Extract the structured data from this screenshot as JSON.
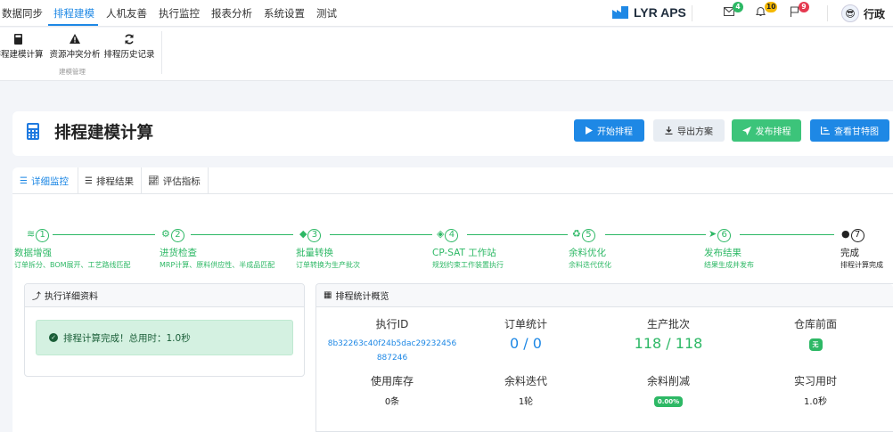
{
  "nav": {
    "items": [
      "数据同步",
      "排程建模",
      "人机友善",
      "执行监控",
      "报表分析",
      "系统设置",
      "测试"
    ],
    "active_index": 1,
    "brand": "LYR APS",
    "badges": {
      "mail": "4",
      "bell": "10",
      "flag": "9"
    },
    "user": "行政"
  },
  "ribbon": {
    "buttons": [
      {
        "icon": "calculator-icon",
        "label": "排程建模计算"
      },
      {
        "icon": "warning-icon",
        "label": "资源冲突分析"
      },
      {
        "icon": "refresh-icon",
        "label": "排程历史记录"
      }
    ],
    "group_label": "建模管理"
  },
  "header": {
    "title": "排程建模计算",
    "buttons": [
      {
        "label": "开始排程",
        "color": "#1e88e5",
        "icon": "play-icon"
      },
      {
        "label": "导出方案",
        "color": "#e8edf3",
        "icon": "download-icon"
      },
      {
        "label": "发布排程",
        "color": "#3cc47a",
        "icon": "send-icon"
      },
      {
        "label": "查看甘特图",
        "color": "#1e88e5",
        "icon": "gantt-icon"
      }
    ]
  },
  "tabs": [
    "详细监控",
    "排程结果",
    "评估指标"
  ],
  "steps": [
    {
      "num": "1",
      "icon": "database-icon",
      "title": "数据增强",
      "desc": "订单拆分、BOM展开、工艺路线匹配"
    },
    {
      "num": "2",
      "icon": "cogs-icon",
      "title": "进货检查",
      "desc": "MRP计算、原料供应性、半成品匹配"
    },
    {
      "num": "3",
      "icon": "cube-icon",
      "title": "批量转换",
      "desc": "订单转换为生产批次"
    },
    {
      "num": "4",
      "icon": "layers-icon",
      "title": "CP-SAT 工作站",
      "desc": "规划约束工作装置执行"
    },
    {
      "num": "5",
      "icon": "recycle-icon",
      "title": "余料优化",
      "desc": "余料迭代优化"
    },
    {
      "num": "6",
      "icon": "publish-icon",
      "title": "发布结果",
      "desc": "结果生成并发布"
    },
    {
      "num": "7",
      "icon": "check-circle-icon",
      "title": "完成",
      "desc": "排程计算完成"
    }
  ],
  "exec_panel": {
    "title": "执行详细资料",
    "message": "排程计算完成！总用时：1.0秒"
  },
  "stats_panel": {
    "title": "排程统计概览",
    "exec_id_label": "执行ID",
    "exec_id_line1": "8b32263c40f24b5dac29232456",
    "exec_id_line2": "887246",
    "order_label": "订单统计",
    "order_value": "0 / 0",
    "batch_label": "生产批次",
    "batch_value": "118 / 118",
    "warehouse_label": "仓库前面",
    "warehouse_value": "无",
    "stock_label": "使用库存",
    "stock_value": "0条",
    "iter_label": "余料迭代",
    "iter_value": "1轮",
    "reduce_label": "余料削减",
    "reduce_value": "0.00%",
    "time_label": "实习用时",
    "time_value": "1.0秒"
  }
}
